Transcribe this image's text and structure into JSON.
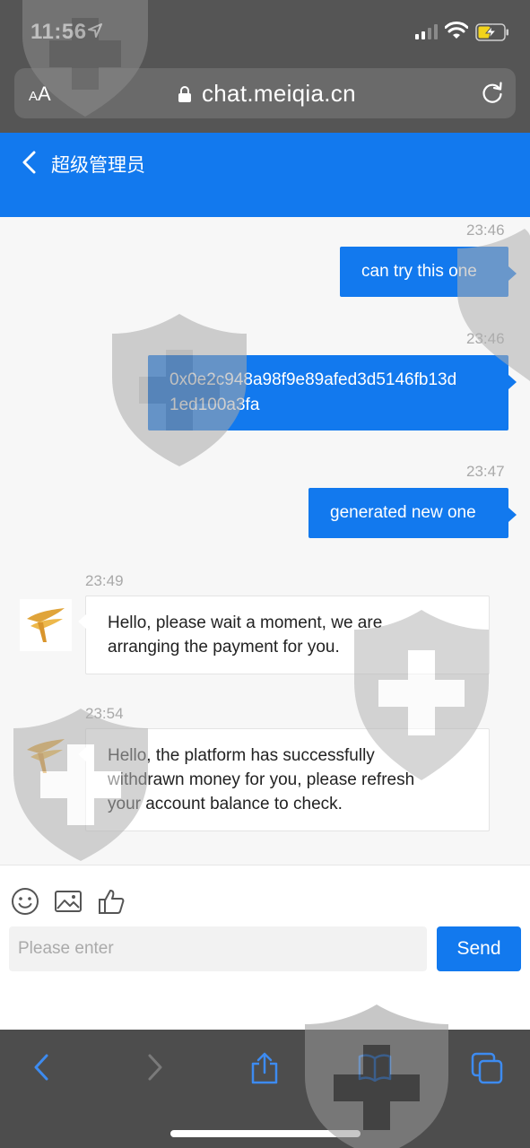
{
  "status_bar": {
    "time": "11:56"
  },
  "browser": {
    "text_size_small": "A",
    "text_size_large": "A",
    "url": "chat.meiqia.cn"
  },
  "header": {
    "title": "超级管理员"
  },
  "messages": [
    {
      "direction": "out",
      "time": "23:46",
      "text": "can try this one"
    },
    {
      "direction": "out",
      "time": "23:46",
      "lines": [
        "0x0e2c948a98f9e89afed3d5146fb13d",
        "1ed100a3fa"
      ]
    },
    {
      "direction": "out",
      "time": "23:47",
      "text": "generated new one"
    },
    {
      "direction": "in",
      "time": "23:49",
      "lines": [
        "Hello, please wait a moment, we are",
        "arranging the payment for you."
      ]
    },
    {
      "direction": "in",
      "time": "23:54",
      "lines": [
        "Hello, the platform has successfully",
        "withdrawn money for you, please refresh",
        "your account balance to check."
      ]
    }
  ],
  "input": {
    "placeholder": "Please enter",
    "value": "",
    "send_label": "Send"
  },
  "toolbar_icons": [
    "emoji-icon",
    "image-icon",
    "thumbs-up-icon"
  ],
  "browser_toolbar": [
    "back-icon",
    "forward-icon",
    "share-icon",
    "bookmarks-icon",
    "tabs-icon"
  ],
  "colors": {
    "accent": "#1279ee",
    "statusbar": "#555555",
    "toolbar": "#4d4d4d",
    "timestamp": "#a9a9a9"
  }
}
